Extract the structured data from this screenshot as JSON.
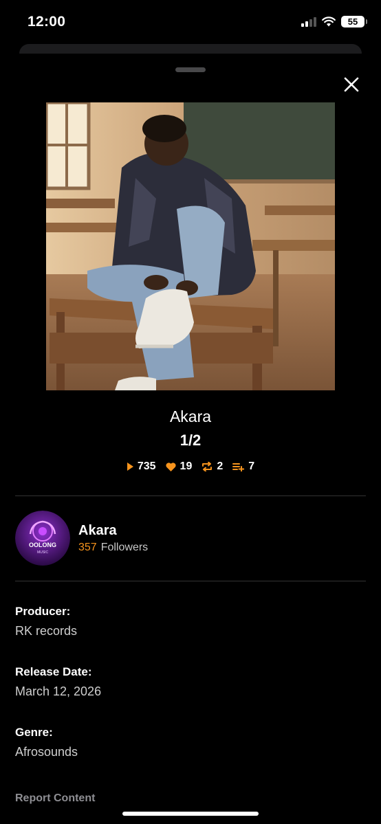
{
  "status_bar": {
    "time": "12:00",
    "battery": "55"
  },
  "track": {
    "title": "Akara",
    "index": "1/2",
    "stats": {
      "plays": "735",
      "likes": "19",
      "reposts": "2",
      "playlist_adds": "7"
    }
  },
  "artist": {
    "name": "Akara",
    "followers_count": "357",
    "followers_label": "Followers",
    "avatar_text_top": "OOLONG",
    "avatar_text_bottom": "MUSIC"
  },
  "details": {
    "producer_label": "Producer:",
    "producer_value": "RK records",
    "release_label": "Release Date:",
    "release_value": "March 12, 2026",
    "genre_label": "Genre:",
    "genre_value": "Afrosounds"
  },
  "actions": {
    "report_label": "Report Content"
  },
  "colors": {
    "accent": "#f7941d",
    "background": "#000000",
    "divider": "#333333"
  },
  "icons": [
    "signal-icon",
    "wifi-icon",
    "battery-icon",
    "close-icon",
    "play-icon",
    "heart-icon",
    "repost-icon",
    "playlist-add-icon"
  ]
}
